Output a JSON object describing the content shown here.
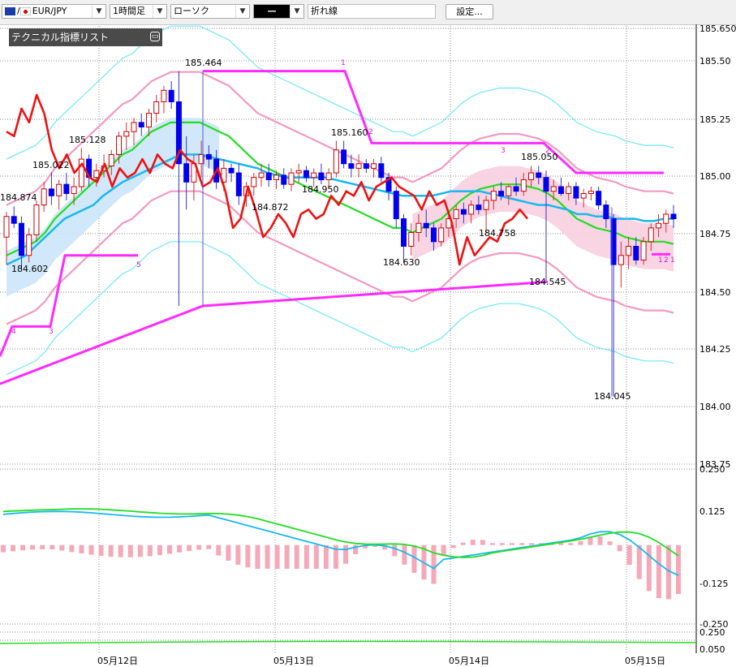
{
  "toolbar": {
    "symbol": "EUR/JPY",
    "symbol_prefix": "/",
    "timeframe": "1時間足",
    "chart_style": "ローソク",
    "line_style": "—",
    "line_type": "折れ線",
    "settings_label": "設定..."
  },
  "indicator_panel": {
    "title": "テクニカル指標リスト"
  },
  "colors": {
    "bull_candle": "#cc0000",
    "bear_candle": "#0000ee",
    "zigzag": "#ff2aff",
    "red_line": "#ee1111",
    "cyan_ma": "#18b8f0",
    "green_ma": "#22dd22",
    "pink_band": "#f29ac0",
    "light_cyan": "#6fe8f8",
    "ichimoku_cloud": "#cce6fa",
    "pink_cloud": "#f8cfe0",
    "macd_hist": "#f5a8b8",
    "grid": "#888888"
  },
  "chart_data": [
    {
      "type": "candlestick",
      "title": "",
      "y_axis_ticks": [
        "185.650",
        "185.50",
        "185.25",
        "185.00",
        "184.75",
        "184.50",
        "184.25",
        "184.00",
        "183.75"
      ],
      "ylim": [
        183.75,
        185.65
      ],
      "x_axis_labels": [
        "05月12日",
        "05月13日",
        "05月14日",
        "05月15日"
      ],
      "annotations": [
        "184.874",
        "185.022",
        "185.128",
        "185.464",
        "184.602",
        "185.160",
        "184.950",
        "184.872",
        "184.630",
        "185.050",
        "184.758",
        "184.545",
        "184.045"
      ],
      "zigzag_labels": [
        "1",
        "2",
        "3",
        "4",
        "5",
        "1",
        "2",
        "3",
        "2",
        "1"
      ],
      "candles": [
        {
          "o": 184.74,
          "h": 184.85,
          "l": 184.62,
          "c": 184.83
        },
        {
          "o": 184.83,
          "h": 184.874,
          "l": 184.78,
          "c": 184.8
        },
        {
          "o": 184.8,
          "h": 184.83,
          "l": 184.602,
          "c": 184.66
        },
        {
          "o": 184.66,
          "h": 184.78,
          "l": 184.63,
          "c": 184.75
        },
        {
          "o": 184.75,
          "h": 184.9,
          "l": 184.72,
          "c": 184.88
        },
        {
          "o": 184.88,
          "h": 184.98,
          "l": 184.85,
          "c": 184.95
        },
        {
          "o": 184.95,
          "h": 185.022,
          "l": 184.88,
          "c": 184.92
        },
        {
          "o": 184.92,
          "h": 184.99,
          "l": 184.86,
          "c": 184.97
        },
        {
          "o": 184.97,
          "h": 185.02,
          "l": 184.9,
          "c": 184.93
        },
        {
          "o": 184.93,
          "h": 185.0,
          "l": 184.88,
          "c": 184.96
        },
        {
          "o": 184.96,
          "h": 185.128,
          "l": 184.94,
          "c": 185.08
        },
        {
          "o": 185.08,
          "h": 185.1,
          "l": 184.96,
          "c": 185.0
        },
        {
          "o": 185.0,
          "h": 185.06,
          "l": 184.96,
          "c": 185.03
        },
        {
          "o": 185.03,
          "h": 185.1,
          "l": 185.0,
          "c": 185.05
        },
        {
          "o": 185.05,
          "h": 185.12,
          "l": 185.01,
          "c": 185.1
        },
        {
          "o": 185.1,
          "h": 185.2,
          "l": 185.06,
          "c": 185.18
        },
        {
          "o": 185.18,
          "h": 185.24,
          "l": 185.12,
          "c": 185.2
        },
        {
          "o": 185.2,
          "h": 185.26,
          "l": 185.14,
          "c": 185.24
        },
        {
          "o": 185.24,
          "h": 185.28,
          "l": 185.18,
          "c": 185.22
        },
        {
          "o": 185.22,
          "h": 185.3,
          "l": 185.18,
          "c": 185.28
        },
        {
          "o": 185.28,
          "h": 185.36,
          "l": 185.24,
          "c": 185.33
        },
        {
          "o": 185.33,
          "h": 185.4,
          "l": 185.28,
          "c": 185.38
        },
        {
          "o": 185.38,
          "h": 185.42,
          "l": 185.3,
          "c": 185.33
        },
        {
          "o": 185.33,
          "h": 185.464,
          "l": 184.44,
          "c": 185.06
        },
        {
          "o": 185.06,
          "h": 185.18,
          "l": 184.86,
          "c": 184.98
        },
        {
          "o": 184.98,
          "h": 185.1,
          "l": 184.9,
          "c": 185.06
        },
        {
          "o": 185.06,
          "h": 185.16,
          "l": 185.0,
          "c": 185.1
        },
        {
          "o": 185.1,
          "h": 185.14,
          "l": 185.04,
          "c": 185.08
        },
        {
          "o": 185.08,
          "h": 185.12,
          "l": 184.95,
          "c": 184.98
        },
        {
          "o": 184.98,
          "h": 185.08,
          "l": 184.94,
          "c": 185.04
        },
        {
          "o": 185.04,
          "h": 185.06,
          "l": 184.98,
          "c": 185.02
        },
        {
          "o": 185.02,
          "h": 185.06,
          "l": 184.88,
          "c": 184.92
        },
        {
          "o": 184.92,
          "h": 184.98,
          "l": 184.872,
          "c": 184.96
        },
        {
          "o": 184.96,
          "h": 185.02,
          "l": 184.92,
          "c": 185.0
        },
        {
          "o": 185.0,
          "h": 185.06,
          "l": 184.96,
          "c": 185.02
        },
        {
          "o": 185.02,
          "h": 185.06,
          "l": 184.96,
          "c": 184.99
        },
        {
          "o": 184.99,
          "h": 185.03,
          "l": 184.95,
          "c": 185.01
        },
        {
          "o": 185.01,
          "h": 185.04,
          "l": 184.95,
          "c": 184.97
        },
        {
          "o": 184.97,
          "h": 185.04,
          "l": 184.94,
          "c": 185.02
        },
        {
          "o": 185.02,
          "h": 185.06,
          "l": 184.98,
          "c": 185.03
        },
        {
          "o": 185.03,
          "h": 185.05,
          "l": 184.98,
          "c": 185.0
        },
        {
          "o": 185.0,
          "h": 185.04,
          "l": 184.96,
          "c": 185.02
        },
        {
          "o": 185.02,
          "h": 185.06,
          "l": 184.97,
          "c": 184.99
        },
        {
          "o": 184.99,
          "h": 185.04,
          "l": 184.95,
          "c": 185.02
        },
        {
          "o": 185.02,
          "h": 185.16,
          "l": 185.0,
          "c": 185.12
        },
        {
          "o": 185.12,
          "h": 185.16,
          "l": 185.04,
          "c": 185.06
        },
        {
          "o": 185.06,
          "h": 185.1,
          "l": 185.0,
          "c": 185.04
        },
        {
          "o": 185.04,
          "h": 185.1,
          "l": 185.0,
          "c": 185.06
        },
        {
          "o": 185.06,
          "h": 185.08,
          "l": 185.02,
          "c": 185.04
        },
        {
          "o": 185.04,
          "h": 185.08,
          "l": 185.0,
          "c": 185.06
        },
        {
          "o": 185.06,
          "h": 185.09,
          "l": 184.98,
          "c": 185.0
        },
        {
          "o": 185.0,
          "h": 185.02,
          "l": 184.9,
          "c": 184.94
        },
        {
          "o": 184.94,
          "h": 184.96,
          "l": 184.78,
          "c": 184.82
        },
        {
          "o": 184.82,
          "h": 184.84,
          "l": 184.63,
          "c": 184.7
        },
        {
          "o": 184.7,
          "h": 184.8,
          "l": 184.66,
          "c": 184.76
        },
        {
          "o": 184.76,
          "h": 184.84,
          "l": 184.72,
          "c": 184.8
        },
        {
          "o": 184.8,
          "h": 184.86,
          "l": 184.74,
          "c": 184.78
        },
        {
          "o": 184.78,
          "h": 184.8,
          "l": 184.68,
          "c": 184.72
        },
        {
          "o": 184.72,
          "h": 184.8,
          "l": 184.7,
          "c": 184.78
        },
        {
          "o": 184.78,
          "h": 184.84,
          "l": 184.74,
          "c": 184.82
        },
        {
          "o": 184.82,
          "h": 184.88,
          "l": 184.78,
          "c": 184.86
        },
        {
          "o": 184.86,
          "h": 184.89,
          "l": 184.8,
          "c": 184.84
        },
        {
          "o": 184.84,
          "h": 184.9,
          "l": 184.8,
          "c": 184.88
        },
        {
          "o": 184.88,
          "h": 184.92,
          "l": 184.84,
          "c": 184.86
        },
        {
          "o": 184.86,
          "h": 184.92,
          "l": 184.758,
          "c": 184.9
        },
        {
          "o": 184.9,
          "h": 184.96,
          "l": 184.86,
          "c": 184.94
        },
        {
          "o": 184.94,
          "h": 184.98,
          "l": 184.9,
          "c": 184.92
        },
        {
          "o": 184.92,
          "h": 184.97,
          "l": 184.88,
          "c": 184.96
        },
        {
          "o": 184.96,
          "h": 185.0,
          "l": 184.92,
          "c": 184.94
        },
        {
          "o": 184.94,
          "h": 185.02,
          "l": 184.92,
          "c": 184.99
        },
        {
          "o": 184.99,
          "h": 185.05,
          "l": 184.96,
          "c": 185.02
        },
        {
          "o": 185.02,
          "h": 185.05,
          "l": 184.97,
          "c": 185.0
        },
        {
          "o": 185.0,
          "h": 185.03,
          "l": 184.545,
          "c": 184.94
        },
        {
          "o": 184.94,
          "h": 184.99,
          "l": 184.9,
          "c": 184.96
        },
        {
          "o": 184.96,
          "h": 185.0,
          "l": 184.92,
          "c": 184.93
        },
        {
          "o": 184.93,
          "h": 184.98,
          "l": 184.9,
          "c": 184.96
        },
        {
          "o": 184.96,
          "h": 184.98,
          "l": 184.88,
          "c": 184.91
        },
        {
          "o": 184.91,
          "h": 184.95,
          "l": 184.87,
          "c": 184.93
        },
        {
          "o": 184.93,
          "h": 184.96,
          "l": 184.9,
          "c": 184.94
        },
        {
          "o": 184.94,
          "h": 184.96,
          "l": 184.86,
          "c": 184.88
        },
        {
          "o": 184.88,
          "h": 184.9,
          "l": 184.78,
          "c": 184.82
        },
        {
          "o": 184.82,
          "h": 184.84,
          "l": 184.045,
          "c": 184.62
        },
        {
          "o": 184.62,
          "h": 184.72,
          "l": 184.52,
          "c": 184.66
        },
        {
          "o": 184.66,
          "h": 184.74,
          "l": 184.6,
          "c": 184.7
        },
        {
          "o": 184.7,
          "h": 184.74,
          "l": 184.62,
          "c": 184.64
        },
        {
          "o": 184.64,
          "h": 184.74,
          "l": 184.62,
          "c": 184.72
        },
        {
          "o": 184.72,
          "h": 184.8,
          "l": 184.68,
          "c": 184.78
        },
        {
          "o": 184.78,
          "h": 184.84,
          "l": 184.74,
          "c": 184.8
        },
        {
          "o": 184.8,
          "h": 184.86,
          "l": 184.76,
          "c": 184.84
        },
        {
          "o": 184.84,
          "h": 184.88,
          "l": 184.78,
          "c": 184.82
        }
      ],
      "red_line": [
        185.2,
        185.18,
        185.3,
        185.24,
        185.36,
        185.28,
        185.12,
        185.04,
        185.1,
        185.02,
        185.06,
        185.0,
        184.98,
        185.06,
        184.96,
        185.04,
        185.0,
        185.02,
        185.08,
        185.02,
        185.1,
        185.06,
        185.04,
        185.12,
        185.08,
        185.06,
        184.96,
        184.98,
        185.04,
        184.94,
        184.78,
        184.82,
        184.96,
        184.86,
        184.74,
        184.78,
        184.84,
        184.8,
        184.74,
        184.84,
        184.86,
        184.82,
        184.84,
        184.92,
        184.88,
        184.94,
        184.92,
        184.98,
        184.9,
        184.96,
        184.98,
        185.0,
        184.96,
        184.94,
        184.92,
        184.86,
        184.94,
        184.88,
        184.9,
        184.8,
        184.62,
        184.74,
        184.66,
        184.7,
        184.74,
        184.72,
        184.8,
        184.82,
        184.86,
        184.82
      ],
      "cyan_ma": [
        184.62,
        184.64,
        184.66,
        184.7,
        184.74,
        184.78,
        184.82,
        184.84,
        184.86,
        184.88,
        184.92,
        184.95,
        184.98,
        185.0,
        185.02,
        185.04,
        185.06,
        185.08,
        185.1,
        185.1,
        185.1,
        185.09,
        185.08,
        185.07,
        185.06,
        185.05,
        185.04,
        185.02,
        185.01,
        185.0,
        185.0,
        185.0,
        185.0,
        185.0,
        184.99,
        184.98,
        184.97,
        184.96,
        184.95,
        184.94,
        184.93,
        184.92,
        184.92,
        184.92,
        184.92,
        184.93,
        184.94,
        184.94,
        184.94,
        184.94,
        184.93,
        184.92,
        184.91,
        184.9,
        184.89,
        184.88,
        184.88,
        184.87,
        184.86,
        184.84,
        184.84,
        184.83,
        184.83,
        184.82,
        184.82,
        184.82,
        184.81,
        184.81,
        184.82,
        184.82
      ],
      "green_ma": [
        184.66,
        184.68,
        184.7,
        184.72,
        184.76,
        184.82,
        184.86,
        184.9,
        184.94,
        184.98,
        185.02,
        185.06,
        185.1,
        185.12,
        185.16,
        185.2,
        185.22,
        185.24,
        185.24,
        185.24,
        185.24,
        185.22,
        185.2,
        185.18,
        185.14,
        185.1,
        185.06,
        185.04,
        185.02,
        185.0,
        184.98,
        184.96,
        184.94,
        184.92,
        184.9,
        184.88,
        184.86,
        184.84,
        184.82,
        184.8,
        184.78,
        184.78,
        184.76,
        184.78,
        184.8,
        184.82,
        184.86,
        184.9,
        184.93,
        184.95,
        184.96,
        184.97,
        184.97,
        184.97,
        184.96,
        184.95,
        184.93,
        184.9,
        184.86,
        184.82,
        184.8,
        184.78,
        184.77,
        184.76,
        184.74,
        184.73,
        184.72,
        184.72,
        184.72,
        184.71
      ]
    },
    {
      "type": "line",
      "title": "",
      "y_axis_ticks": [
        "0.250",
        "0.125",
        "-0.125",
        "-0.250"
      ],
      "ylim": [
        -0.27,
        0.26
      ]
    },
    {
      "type": "line",
      "title": "",
      "y_axis_ticks": [
        "0.250",
        "0.050"
      ]
    }
  ]
}
